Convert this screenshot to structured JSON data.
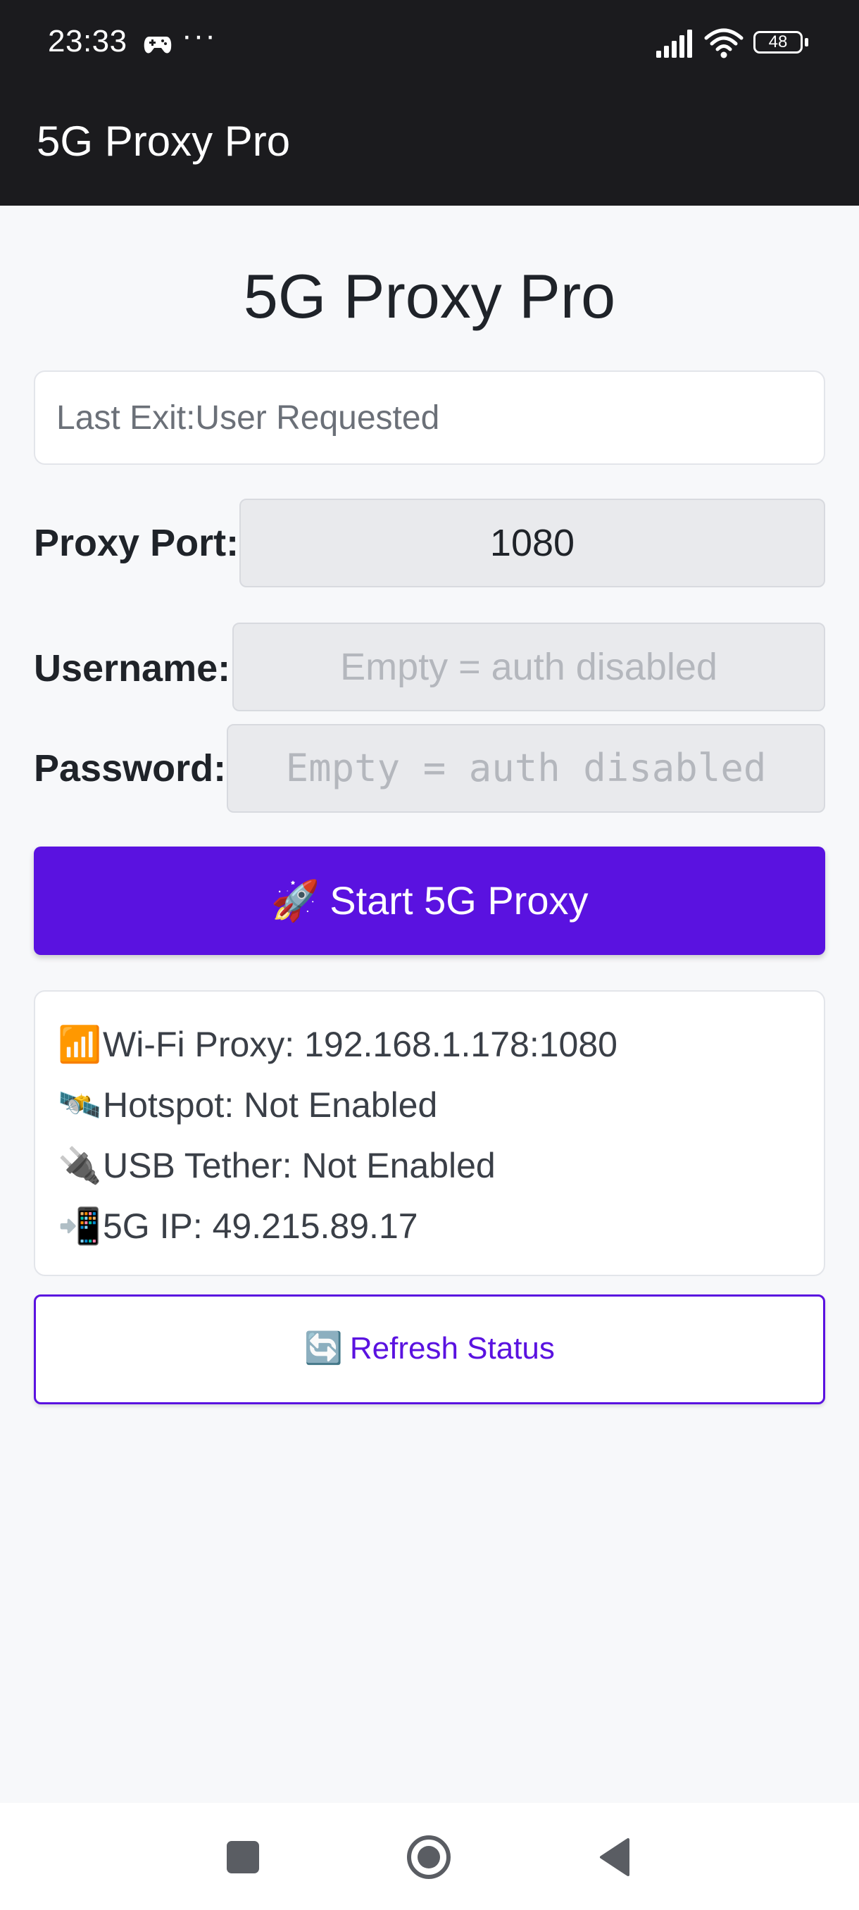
{
  "status_bar": {
    "time": "23:33",
    "more": "···",
    "battery": "48"
  },
  "app_bar": {
    "title": "5G Proxy Pro"
  },
  "main": {
    "title": "5G Proxy Pro",
    "last_exit": "Last Exit:User Requested",
    "port": {
      "label": "Proxy Port:",
      "value": "1080"
    },
    "username": {
      "label": "Username:",
      "placeholder": "Empty = auth disabled"
    },
    "password": {
      "label": "Password:",
      "placeholder": "Empty = auth disabled"
    },
    "start_button": {
      "emoji": "🚀",
      "label": "Start 5G Proxy"
    },
    "status": [
      {
        "emoji": "📶",
        "text": "Wi-Fi Proxy: 192.168.1.178:1080"
      },
      {
        "emoji": "🛰️",
        "text": "Hotspot: Not Enabled"
      },
      {
        "emoji": "🔌",
        "text": "USB Tether: Not Enabled"
      },
      {
        "emoji": "📲",
        "text": "5G IP: 49.215.89.17"
      }
    ],
    "refresh_button": {
      "emoji": "🔄",
      "label": "Refresh Status"
    }
  },
  "colors": {
    "accent": "#5a12e0",
    "topbar": "#1b1b1e",
    "background": "#f7f8fa"
  },
  "icons": {
    "status_bar": [
      "game-controller-icon",
      "signal-icon",
      "wifi-icon",
      "battery-icon"
    ],
    "navigation": [
      "recents-icon",
      "home-icon",
      "back-icon"
    ]
  }
}
